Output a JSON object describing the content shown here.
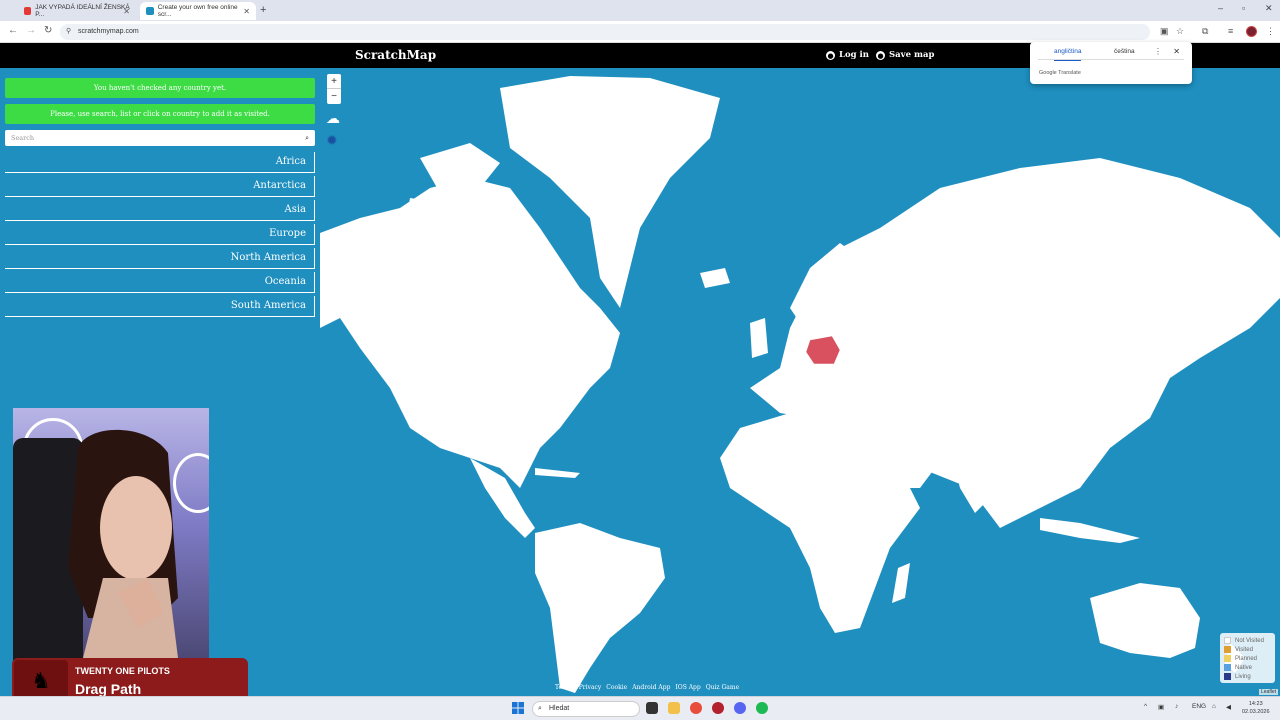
{
  "browser": {
    "tabs": [
      {
        "title": "JAK VYPADÁ IDEÁLNÍ ŽENSKÁ P...",
        "favicon_color": "#e53935"
      },
      {
        "title": "Create your own free online scr...",
        "favicon_color": "#1e8fbf"
      }
    ],
    "url": "scratchmymap.com"
  },
  "site": {
    "brand": "ScratchMap",
    "login_label": "Log in",
    "save_label": "Save map"
  },
  "translate_popup": {
    "lang_source": "angličtina",
    "lang_target": "čeština",
    "footer": "Google Translate"
  },
  "sidebar": {
    "message1": "You haven't checked any country yet.",
    "message2": "Please, use search, list or click on country to add it as visited.",
    "search_placeholder": "Search",
    "continents": [
      "Africa",
      "Antarctica",
      "Asia",
      "Europe",
      "North America",
      "Oceania",
      "South America"
    ]
  },
  "map": {
    "zoom_in": "+",
    "zoom_out": "−",
    "footer_links": [
      "Terms",
      "Privacy",
      "Cookie",
      "Android App",
      "IOS App",
      "Quiz Game"
    ],
    "legend": [
      {
        "label": "Not Visited",
        "color": "#ffffff"
      },
      {
        "label": "Visited",
        "color": "#e0a030"
      },
      {
        "label": "Planned",
        "color": "#f0d060"
      },
      {
        "label": "Native",
        "color": "#5aa0e0"
      },
      {
        "label": "Living",
        "color": "#2a3a8a"
      }
    ],
    "attribution": "Leaflet",
    "highlighted_country": "Poland",
    "colors": {
      "ocean": "#1e8fbf",
      "land": "#ffffff",
      "highlight": "#d9505e"
    }
  },
  "now_playing": {
    "artist": "TWENTY ONE PILOTS",
    "title": "Drag Path"
  },
  "taskbar": {
    "search_placeholder": "Hledat",
    "lang": "ENG",
    "time": "14:23",
    "date": "02.03.2026"
  }
}
